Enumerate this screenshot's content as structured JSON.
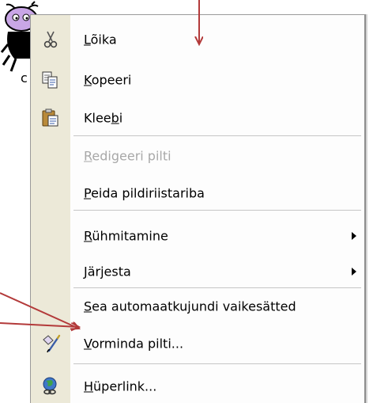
{
  "colors": {
    "arrow": "#b33a3a",
    "gutter": "#ece9d8",
    "disabled_text": "#a8a8a8"
  },
  "background": {
    "partial_text": "c"
  },
  "menu": {
    "items": [
      {
        "pre": "",
        "key": "L",
        "post": "õika",
        "icon": "scissors-icon"
      },
      {
        "pre": "",
        "key": "K",
        "post": "opeeri",
        "icon": "copy-icon"
      },
      {
        "pre": "Klee",
        "key": "b",
        "post": "i",
        "icon": "paste-icon"
      },
      {
        "pre": "",
        "key": "R",
        "post": "edigeeri pilti",
        "disabled": true
      },
      {
        "pre": "",
        "key": "P",
        "post": "eida pildiriistariba"
      },
      {
        "pre": "",
        "key": "R",
        "post": "ühmitamine",
        "submenu": true
      },
      {
        "pre": "",
        "key": "J",
        "post": "ärjesta",
        "submenu": true
      },
      {
        "pre": "",
        "key": "S",
        "post": "ea automaatkujundi vaikesätted"
      },
      {
        "pre": "",
        "key": "V",
        "post": "orminda pilti...",
        "icon": "format-picture-icon"
      },
      {
        "pre": "",
        "key": "H",
        "post": "üperlink...",
        "icon": "hyperlink-globe-icon"
      }
    ]
  }
}
